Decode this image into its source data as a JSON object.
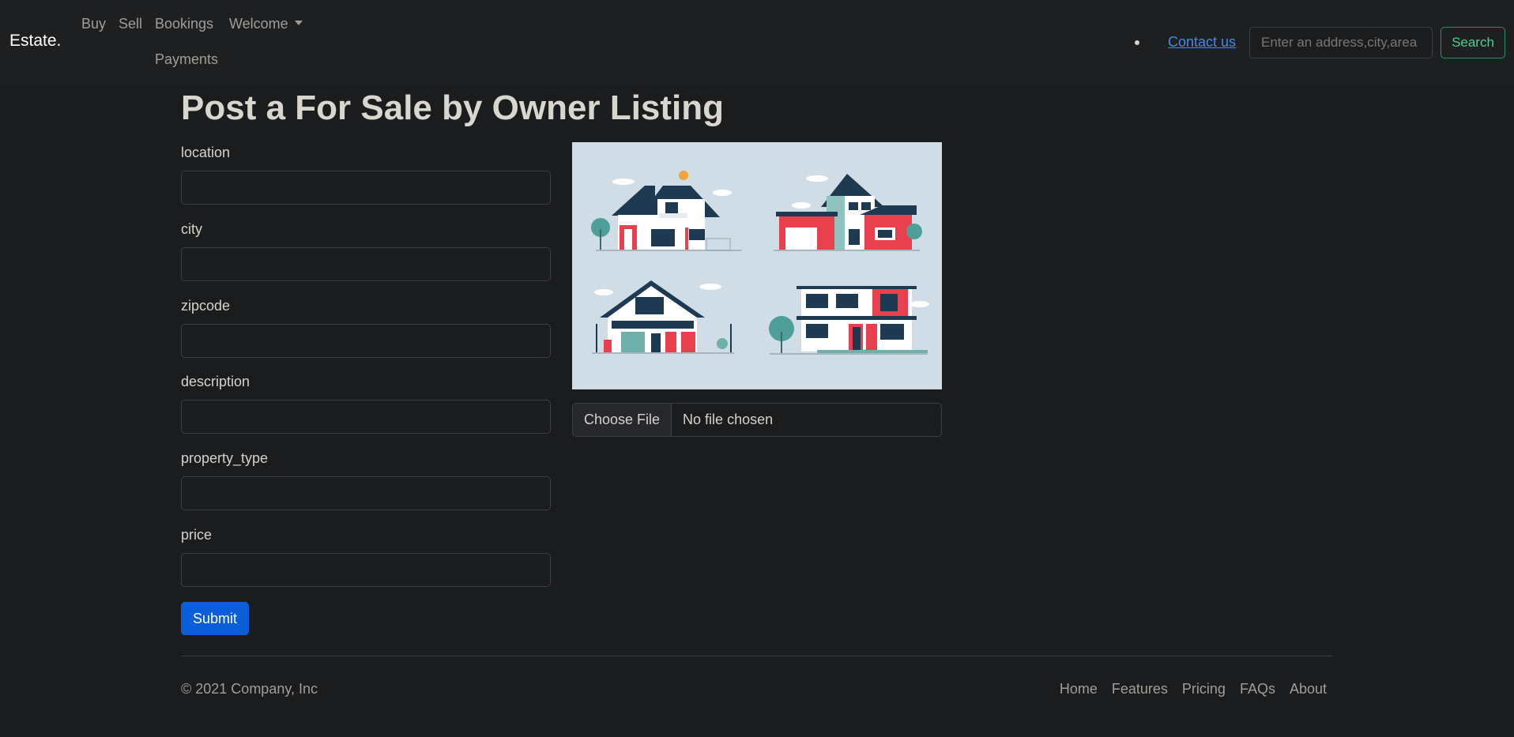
{
  "nav": {
    "brand": "Estate.",
    "links": [
      "Buy",
      "Sell",
      "Bookings",
      "Welcome",
      "Payments"
    ],
    "contact": "Contact us",
    "search_placeholder": "Enter an address,city,area",
    "search_button": "Search"
  },
  "page": {
    "title": "Post a For Sale by Owner Listing"
  },
  "form": {
    "fields": [
      "location",
      "city",
      "zipcode",
      "description",
      "property_type",
      "price"
    ],
    "submit": "Submit",
    "file_button": "Choose File",
    "file_status": "No file chosen"
  },
  "footer": {
    "copyright": "© 2021 Company, Inc",
    "links": [
      "Home",
      "Features",
      "Pricing",
      "FAQs",
      "About"
    ]
  },
  "colors": {
    "background": "#1b1c1e",
    "navbar": "#1e1f21",
    "primary": "#0b5ed7",
    "success_outline": "#2c8e67",
    "link": "#3d8cf0"
  }
}
